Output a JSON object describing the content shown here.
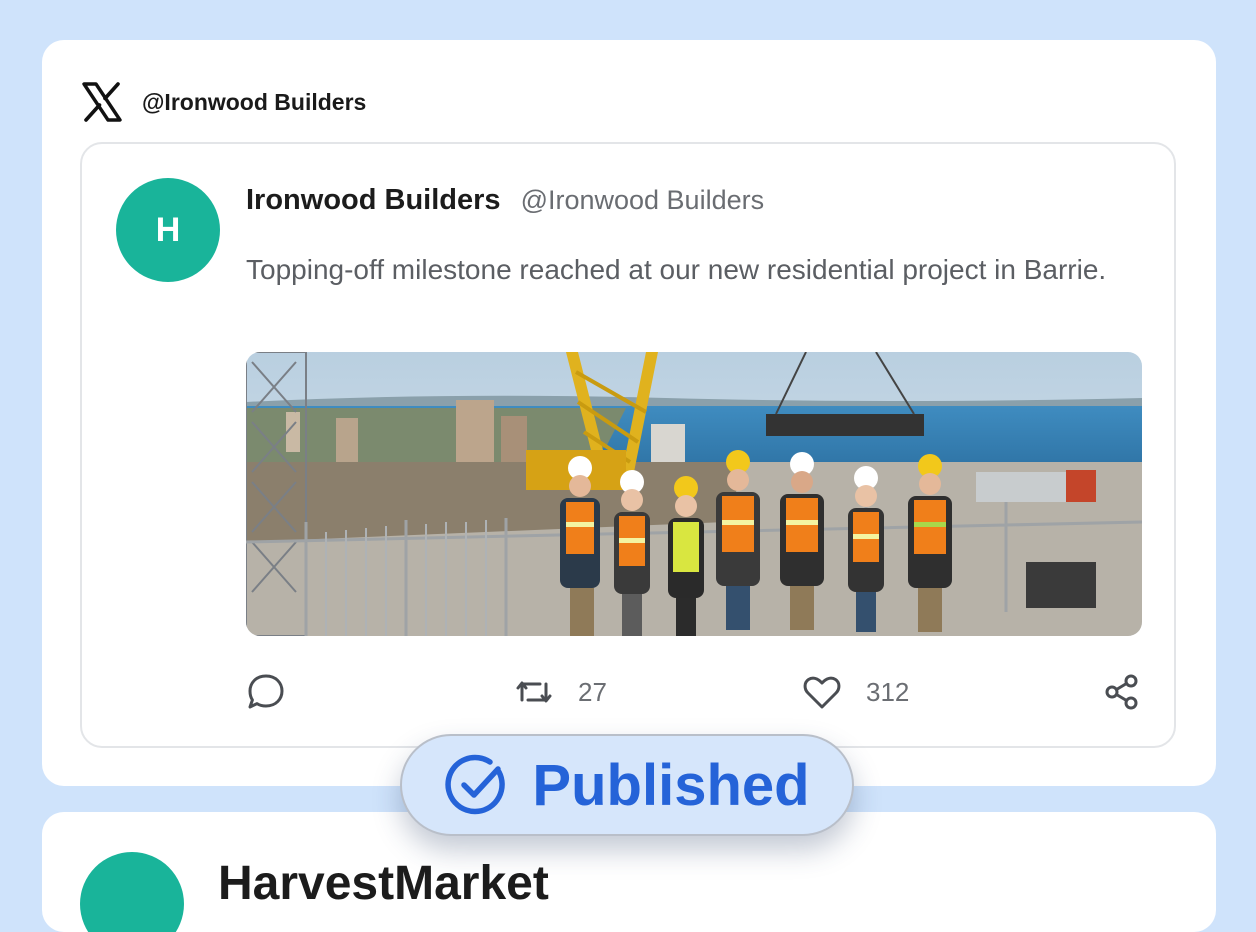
{
  "platform": {
    "handle": "@Ironwood Builders",
    "icon": "x-logo"
  },
  "post": {
    "avatar_initial": "H",
    "author": "Ironwood Builders",
    "handle": "@Ironwood Builders",
    "text": "Topping-off milestone reached at our new residential project in Barrie.",
    "image_alt": "Construction crew in hard hats and safety vests on a rooftop with a crane and lake view",
    "actions": {
      "reply_icon": "comment-icon",
      "repost_icon": "repost-icon",
      "repost_count": "27",
      "like_icon": "heart-icon",
      "like_count": "312",
      "share_icon": "share-icon"
    }
  },
  "status": {
    "label": "Published",
    "icon": "check-circle-icon",
    "color": "#2563d8"
  },
  "next_post": {
    "author": "HarvestMarket"
  },
  "colors": {
    "background": "#cfe3fb",
    "avatar": "#19b49a",
    "accent": "#2563d8"
  }
}
